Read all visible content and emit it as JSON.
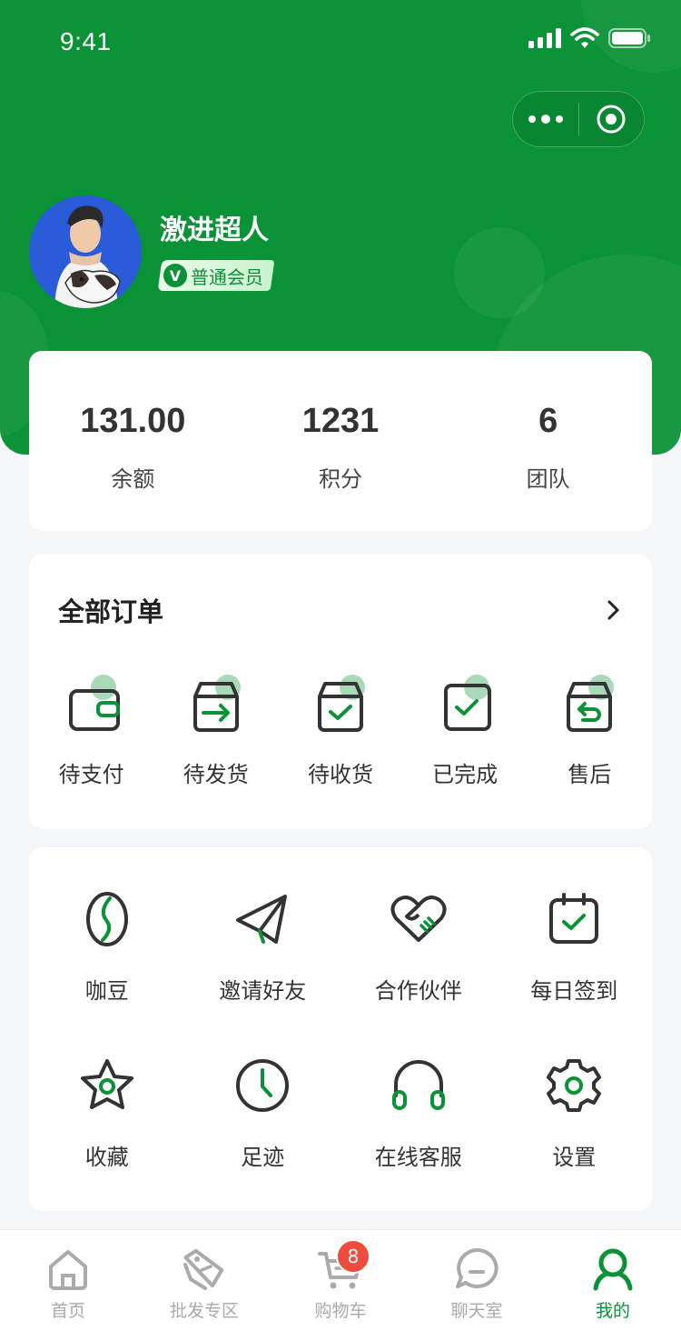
{
  "status_bar": {
    "time": "9:41"
  },
  "profile": {
    "nickname": "激进超人",
    "level_badge_icon": "V",
    "level_badge": "普通会员"
  },
  "stats": [
    {
      "value": "131.00",
      "label": "余额"
    },
    {
      "value": "1231",
      "label": "积分"
    },
    {
      "value": "6",
      "label": "团队"
    }
  ],
  "orders": {
    "title": "全部订单",
    "items": [
      {
        "label": "待支付",
        "icon": "wallet-icon"
      },
      {
        "label": "待发货",
        "icon": "box-arrow-icon"
      },
      {
        "label": "待收货",
        "icon": "box-check-icon"
      },
      {
        "label": "已完成",
        "icon": "check-square-icon"
      },
      {
        "label": "售后",
        "icon": "box-return-icon"
      }
    ]
  },
  "services": [
    {
      "label": "咖豆",
      "icon": "coffee-bean-icon"
    },
    {
      "label": "邀请好友",
      "icon": "paper-plane-icon"
    },
    {
      "label": "合作伙伴",
      "icon": "heart-handshake-icon"
    },
    {
      "label": "每日签到",
      "icon": "calendar-check-icon"
    },
    {
      "label": "收藏",
      "icon": "star-icon"
    },
    {
      "label": "足迹",
      "icon": "clock-icon"
    },
    {
      "label": "在线客服",
      "icon": "headset-icon"
    },
    {
      "label": "设置",
      "icon": "gear-icon"
    }
  ],
  "tabbar": {
    "items": [
      {
        "label": "首页",
        "icon": "home-icon"
      },
      {
        "label": "批发专区",
        "icon": "tags-icon"
      },
      {
        "label": "购物车",
        "icon": "cart-icon"
      },
      {
        "label": "聊天室",
        "icon": "chat-icon"
      },
      {
        "label": "我的",
        "icon": "user-icon"
      }
    ],
    "cart_count": "8",
    "active_index": 4
  },
  "colors": {
    "brand": "#0a9236",
    "background": "#f5f6fa",
    "badge": "#f04c3e",
    "text": "#333333"
  }
}
